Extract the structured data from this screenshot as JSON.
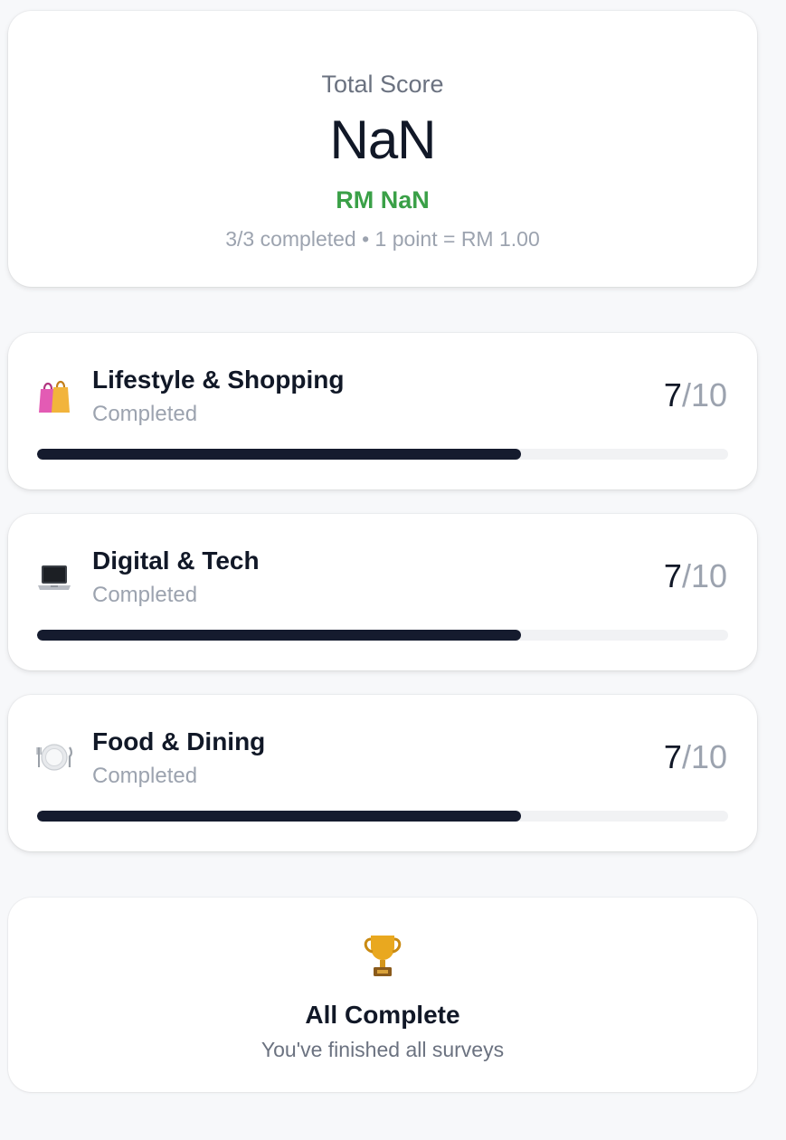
{
  "score": {
    "label": "Total Score",
    "value": "NaN",
    "money": "RM NaN",
    "meta": "3/3 completed • 1 point = RM 1.00"
  },
  "surveys": [
    {
      "title": "Lifestyle & Shopping",
      "status": "Completed",
      "score": "7",
      "total": "/10",
      "icon": "shopping-bags-icon",
      "progress": 0.7
    },
    {
      "title": "Digital & Tech",
      "status": "Completed",
      "score": "7",
      "total": "/10",
      "icon": "laptop-icon",
      "progress": 0.7
    },
    {
      "title": "Food & Dining",
      "status": "Completed",
      "score": "7",
      "total": "/10",
      "icon": "plate-cutlery-icon",
      "progress": 0.7
    }
  ],
  "completion": {
    "title": "All Complete",
    "subtitle": "You've finished all surveys",
    "icon": "trophy-icon"
  },
  "colors": {
    "accent_green": "#3aa047",
    "progress_fill": "#151b2e",
    "progress_track": "#f1f2f4"
  }
}
